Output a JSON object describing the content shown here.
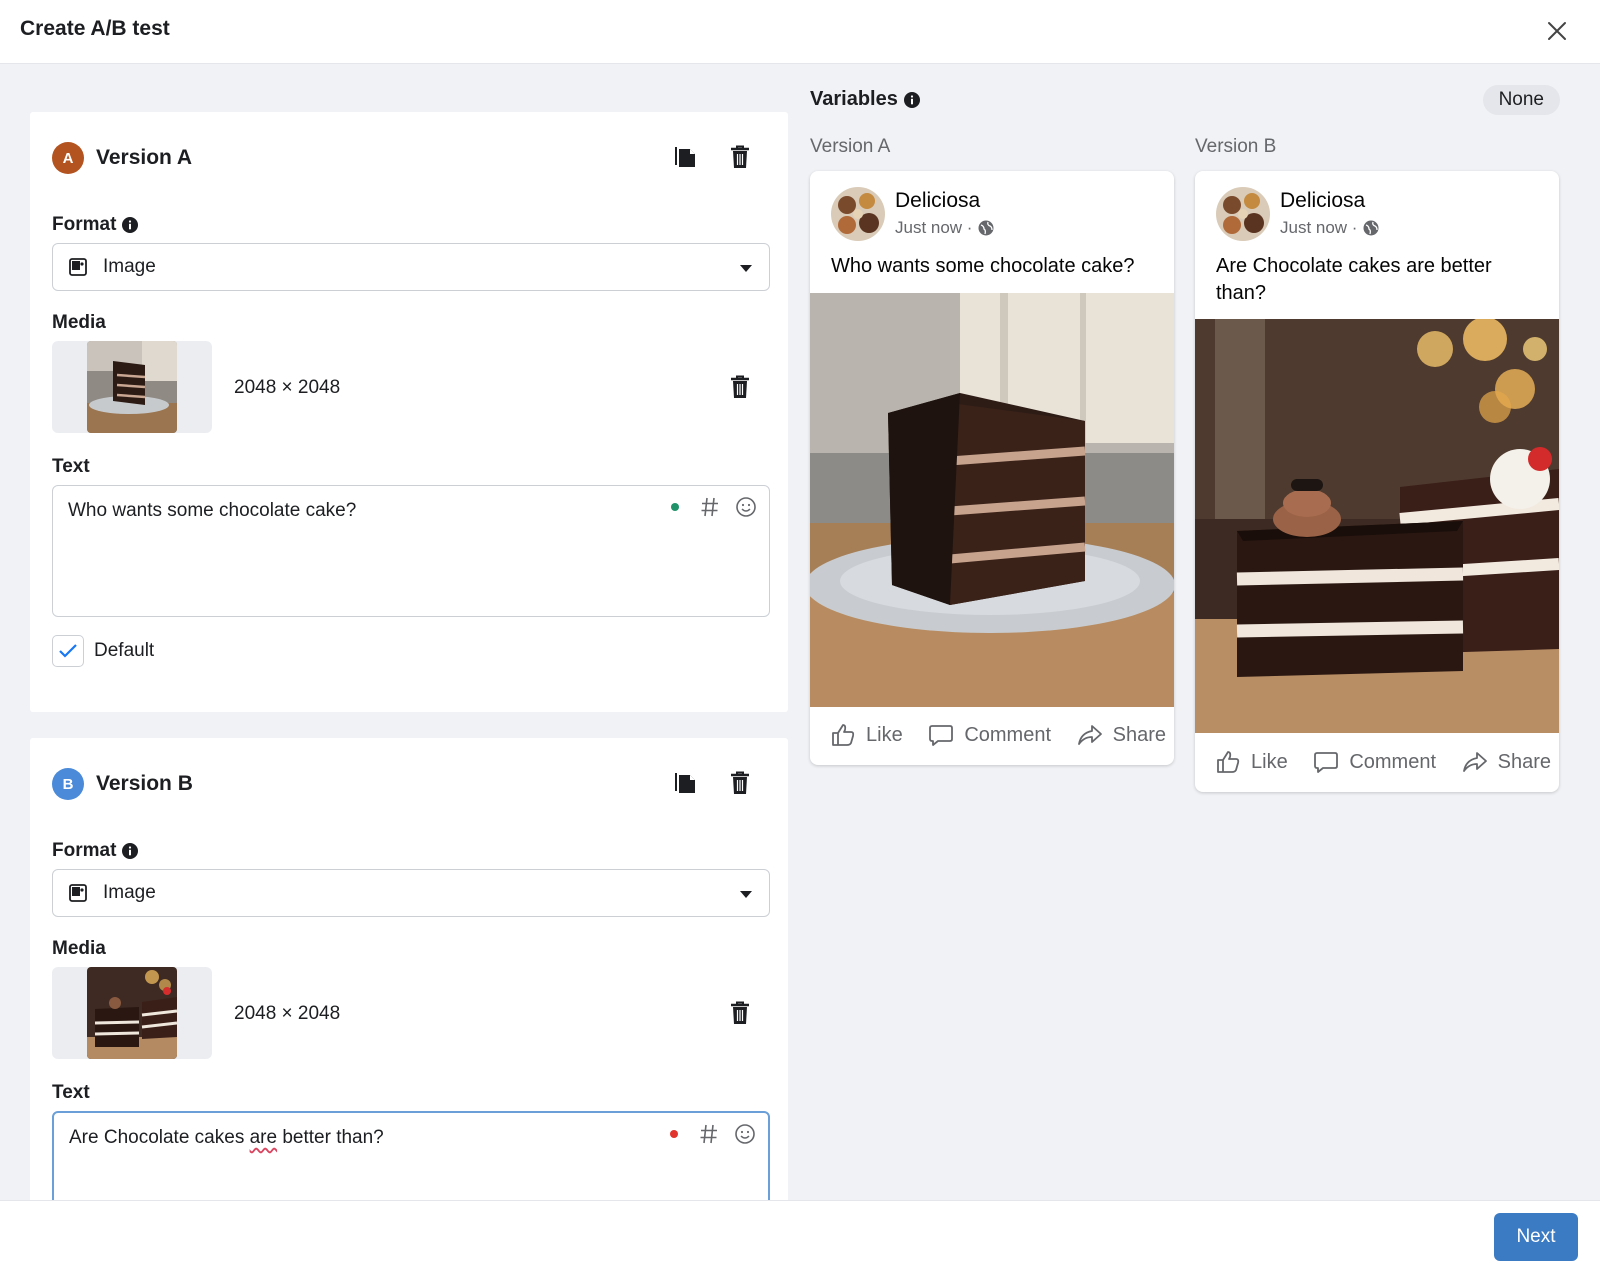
{
  "header": {
    "title": "Create A/B test"
  },
  "versions": [
    {
      "badge": "A",
      "badge_color": "#b3531f",
      "name": "Version A",
      "format_label": "Format",
      "format_value": "Image",
      "media_label": "Media",
      "media_dims": "2048 × 2048",
      "text_label": "Text",
      "text_value": "Who wants some chocolate cake?",
      "status_dot_color": "#21936a",
      "default_label": "Default",
      "default_checked": true
    },
    {
      "badge": "B",
      "badge_color": "#4a8ad8",
      "name": "Version B",
      "format_label": "Format",
      "format_value": "Image",
      "media_label": "Media",
      "media_dims": "2048 × 2048",
      "text_label": "Text",
      "text_before": "Are Chocolate cakes ",
      "text_flagged": "are",
      "text_after": " better than?",
      "status_dot_color": "#e0342c"
    }
  ],
  "preview": {
    "variables_label": "Variables",
    "variables_value": "None",
    "columns": [
      {
        "label": "Version A",
        "page_name": "Deliciosa",
        "time": "Just now ·",
        "text": "Who wants some chocolate cake?"
      },
      {
        "label": "Version B",
        "page_name": "Deliciosa",
        "time": "Just now ·",
        "text": "Are Chocolate cakes are better than?"
      }
    ],
    "actions": {
      "like": "Like",
      "comment": "Comment",
      "share": "Share"
    }
  },
  "footer": {
    "next_label": "Next",
    "next_color": "#3b7bc4"
  }
}
